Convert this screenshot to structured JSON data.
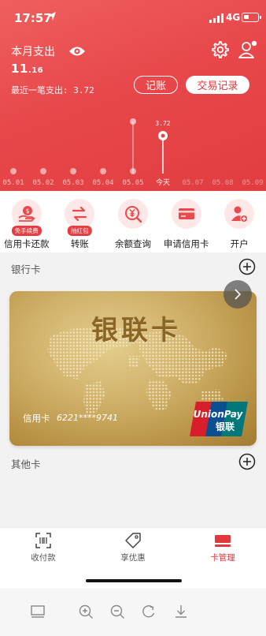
{
  "status_bar": {
    "time": "17:57",
    "network": "4G"
  },
  "header": {
    "month_label": "本月支出",
    "month_amount_main": "11",
    "month_amount_decimal": ".16",
    "last_spend": "最近一笔支出: 3.72",
    "record_button": "记账",
    "transactions_button": "交易记录"
  },
  "timeline": {
    "dates": [
      "05.01",
      "05.02",
      "05.03",
      "05.04",
      "05.05",
      "今天",
      "05.07",
      "05.08",
      "05.09"
    ],
    "today_value": "3.72"
  },
  "quick_actions": [
    {
      "label": "信用卡还款",
      "badge": "免手续费",
      "icon": "hand-coin-icon"
    },
    {
      "label": "转账",
      "badge": "抽红包",
      "icon": "transfer-arrows-icon"
    },
    {
      "label": "余额查询",
      "badge": "",
      "icon": "yen-search-icon"
    },
    {
      "label": "申请信用卡",
      "badge": "",
      "icon": "credit-card-icon"
    },
    {
      "label": "开户",
      "badge": "",
      "icon": "add-user-icon"
    }
  ],
  "bank_cards_section": {
    "title": "银行卡"
  },
  "card": {
    "title": "银联卡",
    "type_label": "信用卡",
    "number": "6221****9741",
    "brand_en": "UnionPay",
    "brand_cn": "银联"
  },
  "other_cards_section": {
    "title": "其他卡"
  },
  "tabbar": {
    "tabs": [
      {
        "label": "收付款",
        "icon": "scan-pay-icon"
      },
      {
        "label": "享优惠",
        "icon": "tag-icon"
      },
      {
        "label": "卡管理",
        "icon": "card-manage-icon"
      }
    ],
    "active_index": 2
  },
  "colors": {
    "brand_red": "#e0393e",
    "card_gold": "#c9a85e"
  }
}
